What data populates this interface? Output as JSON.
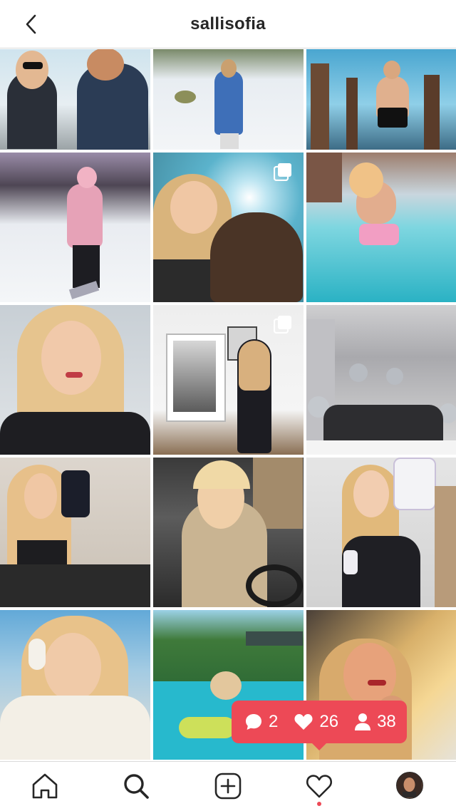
{
  "header": {
    "username": "sallisofia"
  },
  "grid": {
    "posts": [
      {
        "name": "post-1-selfie-couple",
        "multi": false
      },
      {
        "name": "post-2-blue-coat-snow",
        "multi": false
      },
      {
        "name": "post-3-ice-swim",
        "multi": false
      },
      {
        "name": "post-4-ski-slope",
        "multi": false
      },
      {
        "name": "post-5-dog-sunshine",
        "multi": true
      },
      {
        "name": "post-6-hot-tub",
        "multi": false
      },
      {
        "name": "post-7-portrait",
        "multi": false
      },
      {
        "name": "post-8-wall-art",
        "multi": true
      },
      {
        "name": "post-9-balloon-party",
        "multi": false
      },
      {
        "name": "post-10-mirror-selfie",
        "multi": false
      },
      {
        "name": "post-11-car-selfie",
        "multi": false
      },
      {
        "name": "post-12-product",
        "multi": false
      },
      {
        "name": "post-13-winter-fleece",
        "multi": false
      },
      {
        "name": "post-14-pool",
        "multi": false
      },
      {
        "name": "post-15-sunset-portrait",
        "multi": false
      }
    ]
  },
  "activity": {
    "comments": "2",
    "likes": "26",
    "followers": "38"
  },
  "colors": {
    "accent": "#ed4956",
    "text": "#262626"
  },
  "nav": {
    "items": [
      {
        "icon": "home-icon",
        "label": "Home"
      },
      {
        "icon": "search-icon",
        "label": "Search"
      },
      {
        "icon": "new-post-icon",
        "label": "New post"
      },
      {
        "icon": "heart-icon",
        "label": "Activity"
      },
      {
        "icon": "avatar",
        "label": "Profile"
      }
    ]
  }
}
